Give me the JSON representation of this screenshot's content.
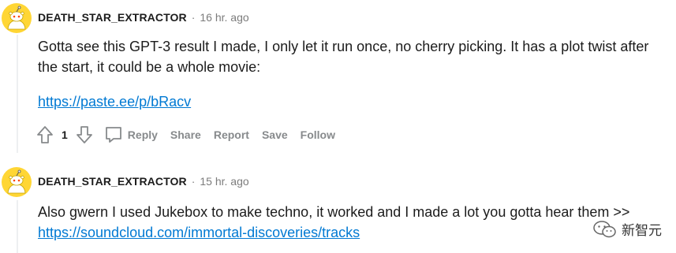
{
  "comments": [
    {
      "author": "DEATH_STAR_EXTRACTOR",
      "separator": "·",
      "time": "16 hr. ago",
      "text": "Gotta see this GPT-3 result I made, I only let it run once, no cherry picking. It has a plot twist after the start, it could be a whole movie:",
      "link": "https://paste.ee/p/bRacv",
      "score": "1",
      "actions": {
        "reply": "Reply",
        "share": "Share",
        "report": "Report",
        "save": "Save",
        "follow": "Follow"
      }
    },
    {
      "author": "DEATH_STAR_EXTRACTOR",
      "separator": "·",
      "time": "15 hr. ago",
      "text": "Also gwern I used Jukebox to make techno, it worked and I made a lot you gotta hear them >>",
      "link": "https://soundcloud.com/immortal-discoveries/tracks"
    }
  ],
  "watermark": {
    "text": "新智元"
  },
  "colors": {
    "link": "#0079d3",
    "meta": "#7c7c7c",
    "action": "#878a8c",
    "avatar": "#ffd635"
  },
  "icons": {
    "avatar": "snoo-avatar",
    "upvote": "upvote-arrow",
    "downvote": "downvote-arrow",
    "reply": "comment-bubble",
    "watermark": "wechat-logo"
  }
}
